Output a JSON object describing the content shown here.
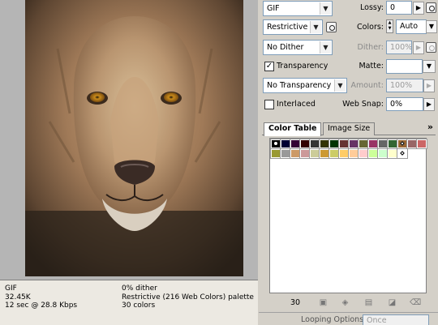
{
  "preview": {
    "info_left": [
      "GIF",
      "32.45K",
      "12 sec @ 28.8 Kbps"
    ],
    "info_right": [
      "0% dither",
      "Restrictive (216 Web Colors) palette",
      "30 colors"
    ]
  },
  "settings": {
    "format": "GIF",
    "palette": "Restrictive (...",
    "dither": "No Dither",
    "transparency_label": "Transparency",
    "transparency_checked": true,
    "transparency_dither": "No Transparency ...",
    "interlaced_label": "Interlaced",
    "interlaced_checked": false,
    "lossy_label": "Lossy:",
    "lossy_value": "0",
    "colors_label": "Colors:",
    "colors_value": "Auto",
    "dither_label": "Dither:",
    "dither_value": "100%",
    "matte_label": "Matte:",
    "matte_value": "",
    "amount_label": "Amount:",
    "amount_value": "100%",
    "websnap_label": "Web Snap:",
    "websnap_value": "0%"
  },
  "tabs": [
    {
      "label": "Color Table",
      "active": true
    },
    {
      "label": "Image Size",
      "active": false
    }
  ],
  "panel_menu_glyph": "»",
  "color_table": {
    "count": "30",
    "swatches": [
      {
        "color": "#000000",
        "marker": "dot"
      },
      {
        "color": "#000033",
        "marker": ""
      },
      {
        "color": "#330033",
        "marker": ""
      },
      {
        "color": "#330000",
        "marker": ""
      },
      {
        "color": "#333333",
        "marker": ""
      },
      {
        "color": "#333300",
        "marker": ""
      },
      {
        "color": "#003300",
        "marker": ""
      },
      {
        "color": "#663333",
        "marker": ""
      },
      {
        "color": "#663366",
        "marker": ""
      },
      {
        "color": "#666633",
        "marker": ""
      },
      {
        "color": "#993366",
        "marker": ""
      },
      {
        "color": "#666666",
        "marker": ""
      },
      {
        "color": "#336633",
        "marker": ""
      },
      {
        "color": "#996633",
        "marker": "diamond"
      },
      {
        "color": "#996666",
        "marker": ""
      },
      {
        "color": "#cc6666",
        "marker": ""
      },
      {
        "color": "#999933",
        "marker": ""
      },
      {
        "color": "#999999",
        "marker": ""
      },
      {
        "color": "#cc9966",
        "marker": ""
      },
      {
        "color": "#cc9999",
        "marker": ""
      },
      {
        "color": "#cccc99",
        "marker": ""
      },
      {
        "color": "#cc9933",
        "marker": ""
      },
      {
        "color": "#cccc66",
        "marker": ""
      },
      {
        "color": "#ffcc66",
        "marker": ""
      },
      {
        "color": "#ffcc99",
        "marker": ""
      },
      {
        "color": "#ffcccc",
        "marker": ""
      },
      {
        "color": "#ccff99",
        "marker": ""
      },
      {
        "color": "#ccffcc",
        "marker": ""
      },
      {
        "color": "#ffffcc",
        "marker": ""
      },
      {
        "color": "#ffffff",
        "marker": "diamond"
      }
    ]
  },
  "looping": {
    "label": "Looping Options:",
    "value": "Once"
  }
}
